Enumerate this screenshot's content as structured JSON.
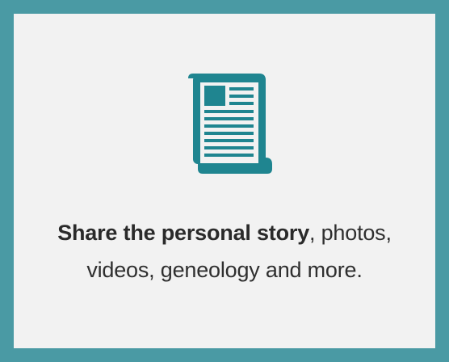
{
  "card": {
    "icon": "scroll-document-icon",
    "accent_color": "#4a9aa4",
    "background_color": "#f2f2f2",
    "caption": {
      "bold_text": "Share the personal story",
      "line1_rest": ", photos,",
      "line2": "videos, geneology and more."
    }
  }
}
